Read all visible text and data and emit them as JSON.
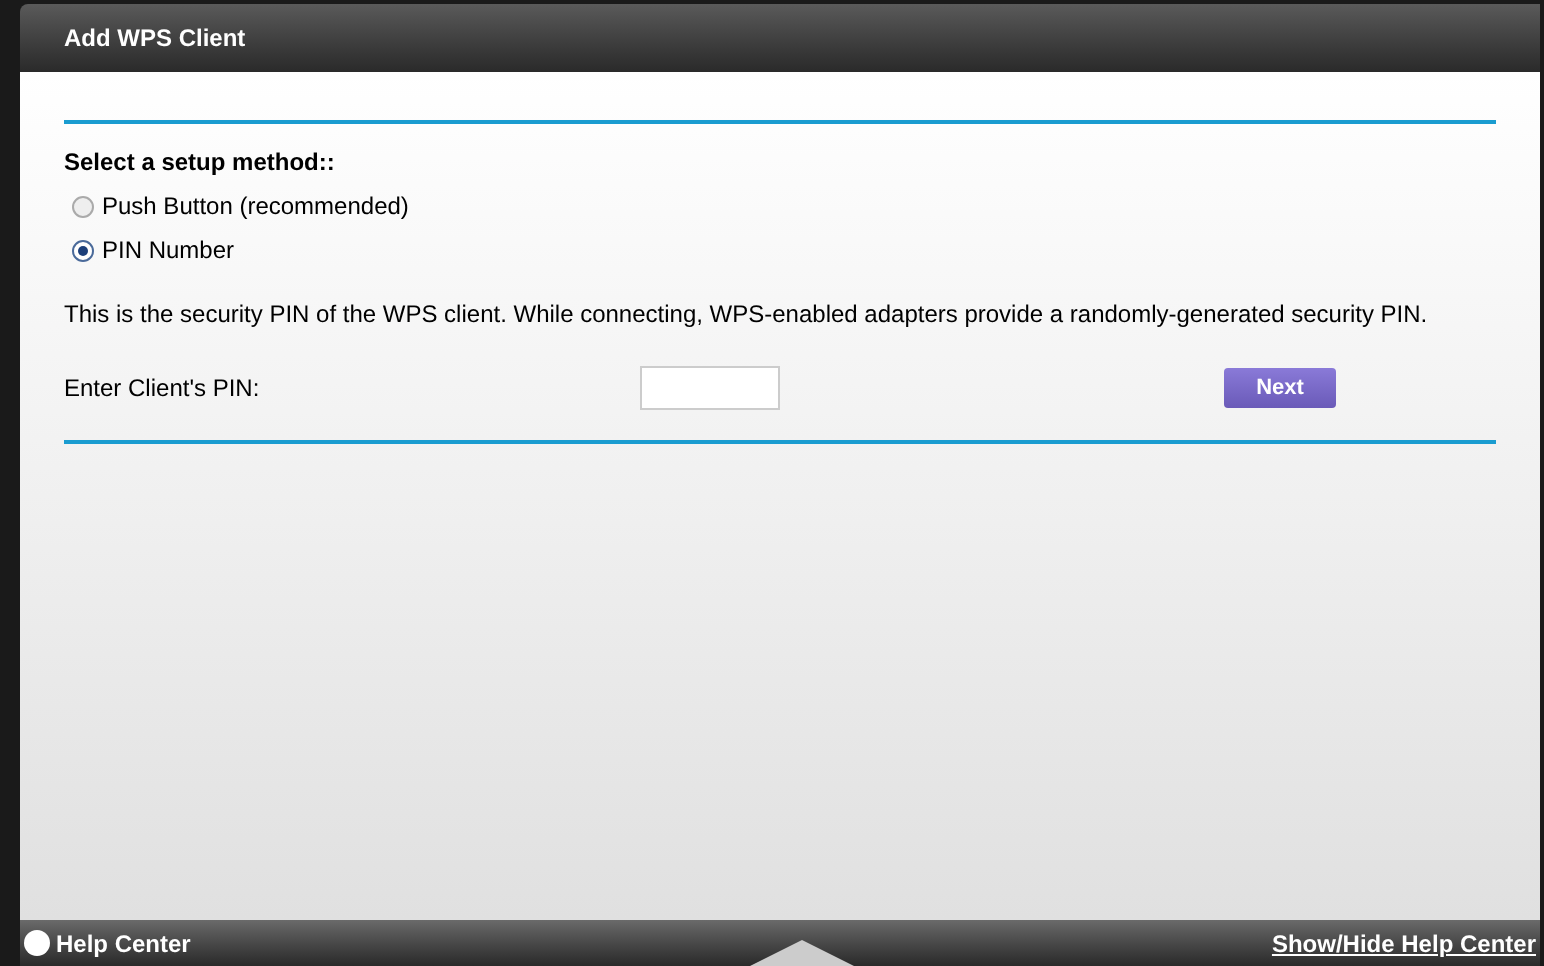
{
  "window": {
    "title": "Add WPS Client"
  },
  "setup": {
    "label": "Select a setup method::",
    "options": [
      {
        "label": "Push Button (recommended)",
        "selected": false
      },
      {
        "label": "PIN Number",
        "selected": true
      }
    ]
  },
  "description": "This is the security PIN of the WPS client. While connecting, WPS-enabled adapters provide a randomly-generated security PIN.",
  "pin": {
    "label": "Enter Client's PIN:"
  },
  "buttons": [
    "Next"
  ],
  "footer": {
    "help": "Help Center",
    "toggle": "Show/Hide Help Center"
  }
}
